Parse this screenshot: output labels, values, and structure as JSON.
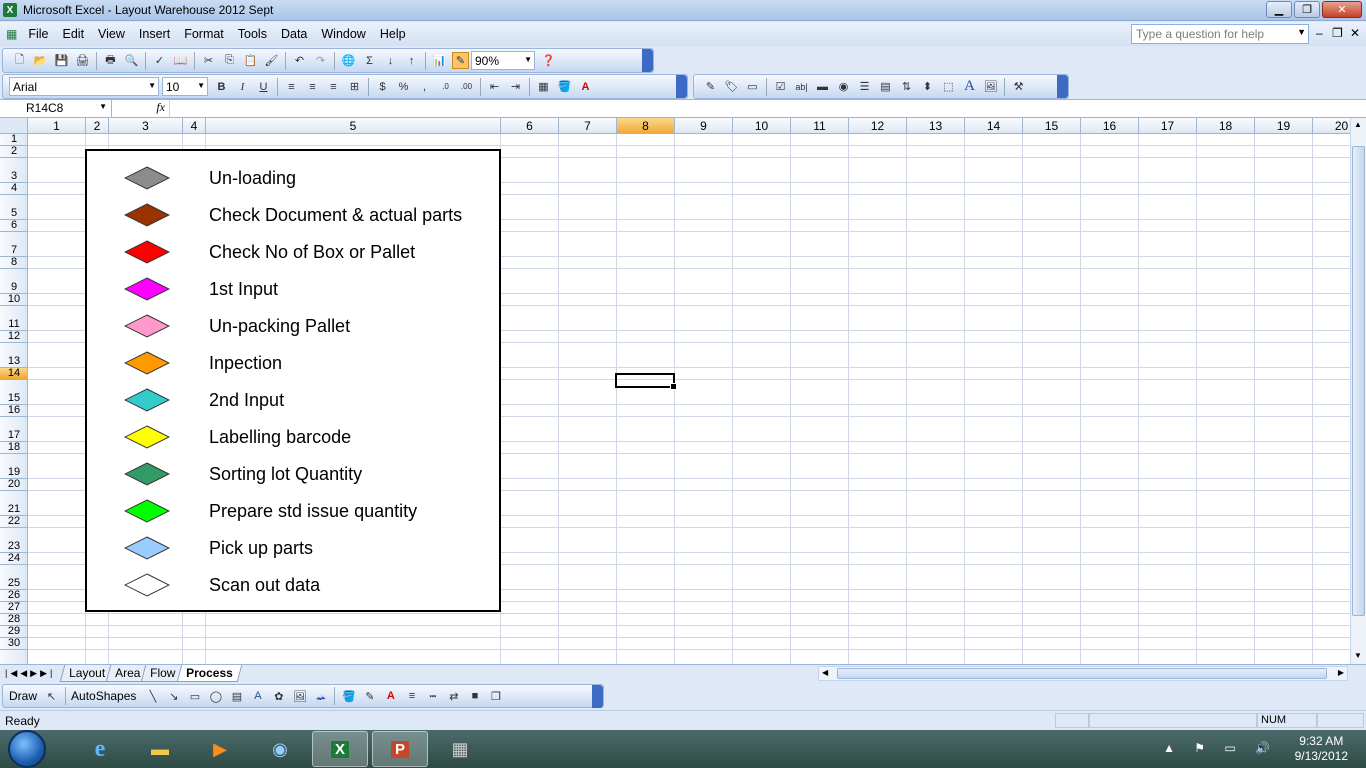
{
  "window": {
    "title": "Microsoft Excel - Layout Warehouse 2012 Sept",
    "minimize": "▁",
    "restore": "❐",
    "close": "✕"
  },
  "menu": [
    "File",
    "Edit",
    "View",
    "Insert",
    "Format",
    "Tools",
    "Data",
    "Window",
    "Help"
  ],
  "help_placeholder": "Type a question for help",
  "zoom": "90%",
  "font_name": "Arial",
  "font_size": "10",
  "name_box": "R14C8",
  "fx_label": "fx",
  "columns": [
    "1",
    "2",
    "3",
    "4",
    "5",
    "6",
    "7",
    "8",
    "9",
    "10",
    "11",
    "12",
    "13",
    "14",
    "15",
    "16",
    "17",
    "18",
    "19",
    "20"
  ],
  "rows": [
    "1",
    "2",
    "3",
    "4",
    "5",
    "6",
    "7",
    "8",
    "9",
    "10",
    "11",
    "12",
    "13",
    "14",
    "15",
    "16",
    "17",
    "18",
    "19",
    "20",
    "21",
    "22",
    "23",
    "24",
    "25",
    "26",
    "27",
    "28",
    "29",
    "30"
  ],
  "selected_column": "8",
  "selected_row": "14",
  "legend": [
    {
      "label": "Un-loading",
      "color": "#8c8c8c"
    },
    {
      "label": "Check Document & actual parts",
      "color": "#993300"
    },
    {
      "label": "Check No of Box or Pallet",
      "color": "#ff0000"
    },
    {
      "label": "1st Input",
      "color": "#ff00ff"
    },
    {
      "label": "Un-packing Pallet",
      "color": "#ff99cc"
    },
    {
      "label": "Inpection",
      "color": "#ff9900"
    },
    {
      "label": "2nd Input",
      "color": "#33cccc"
    },
    {
      "label": "Labelling barcode",
      "color": "#ffff00"
    },
    {
      "label": "Sorting lot Quantity",
      "color": "#339966"
    },
    {
      "label": "Prepare std issue quantity",
      "color": "#00ff00"
    },
    {
      "label": "Pick up parts",
      "color": "#99ccff"
    },
    {
      "label": "Scan out data",
      "color": "#ffffff"
    }
  ],
  "sheets": [
    {
      "name": "Layout",
      "active": false
    },
    {
      "name": "Area",
      "active": false
    },
    {
      "name": "Flow",
      "active": false
    },
    {
      "name": "Process",
      "active": true
    }
  ],
  "draw_toolbar": {
    "draw": "Draw",
    "autoshapes": "AutoShapes"
  },
  "status": {
    "text": "Ready",
    "num": "NUM"
  },
  "taskbar": {
    "time": "9:32 AM",
    "date": "9/13/2012"
  }
}
